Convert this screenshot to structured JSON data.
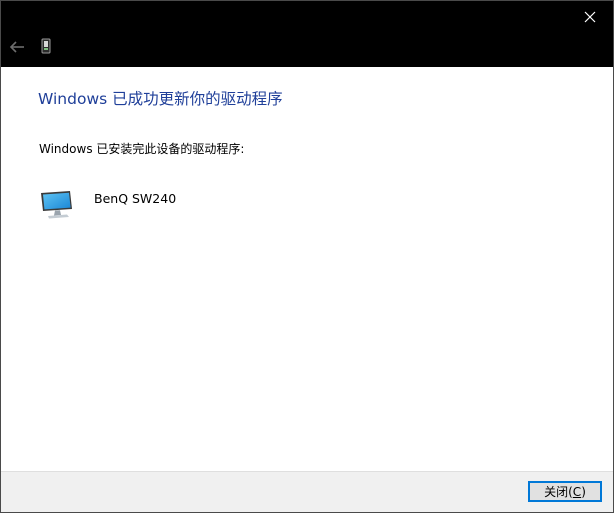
{
  "titlebar": {
    "close_icon": "close-icon",
    "back_icon": "back-arrow-icon",
    "device_icon": "device-icon"
  },
  "content": {
    "heading": "Windows 已成功更新你的驱动程序",
    "subtext": "Windows 已安装完此设备的驱动程序:",
    "device": {
      "name": "BenQ SW240",
      "icon": "monitor-icon"
    }
  },
  "footer": {
    "close_button": {
      "label_prefix": "关闭(",
      "accesskey": "C",
      "label_suffix": ")"
    }
  },
  "colors": {
    "titlebar_bg": "#000000",
    "heading": "#1f3f99",
    "footer_bg": "#f0f0f0",
    "button_focus_border": "#0078d7"
  }
}
